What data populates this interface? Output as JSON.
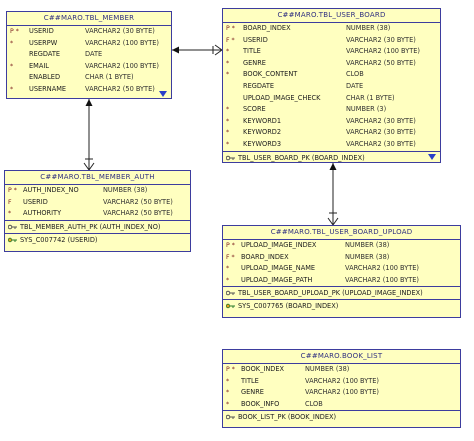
{
  "entities": {
    "member": {
      "title": "C##MARO.TBL_MEMBER",
      "columns": [
        {
          "flags": "P *",
          "name": "USERID",
          "type": "VARCHAR2 (30 BYTE)"
        },
        {
          "flags": "*",
          "name": "USERPW",
          "type": "VARCHAR2 (100 BYTE)"
        },
        {
          "flags": "",
          "name": "REGDATE",
          "type": "DATE"
        },
        {
          "flags": "*",
          "name": "EMAIL",
          "type": "VARCHAR2 (100 BYTE)"
        },
        {
          "flags": "",
          "name": "ENABLED",
          "type": "CHAR (1 BYTE)"
        },
        {
          "flags": "*",
          "name": "USERNAME",
          "type": "VARCHAR2 (50 BYTE)"
        }
      ]
    },
    "board": {
      "title": "C##MARO.TBL_USER_BOARD",
      "columns": [
        {
          "flags": "P *",
          "name": "BOARD_INDEX",
          "type": "NUMBER (38)"
        },
        {
          "flags": "F *",
          "name": "USERID",
          "type": "VARCHAR2 (30 BYTE)"
        },
        {
          "flags": "*",
          "name": "TITLE",
          "type": "VARCHAR2 (100 BYTE)"
        },
        {
          "flags": "*",
          "name": "GENRE",
          "type": "VARCHAR2 (50 BYTE)"
        },
        {
          "flags": "*",
          "name": "BOOK_CONTENT",
          "type": "CLOB"
        },
        {
          "flags": "",
          "name": "REGDATE",
          "type": "DATE"
        },
        {
          "flags": "",
          "name": "UPLOAD_IMAGE_CHECK",
          "type": "CHAR (1 BYTE)"
        },
        {
          "flags": "*",
          "name": "SCORE",
          "type": "NUMBER (3)"
        },
        {
          "flags": "*",
          "name": "KEYWORD1",
          "type": "VARCHAR2 (30 BYTE)"
        },
        {
          "flags": "*",
          "name": "KEYWORD2",
          "type": "VARCHAR2 (30 BYTE)"
        },
        {
          "flags": "*",
          "name": "KEYWORD3",
          "type": "VARCHAR2 (30 BYTE)"
        }
      ],
      "pk": "TBL_USER_BOARD_PK (BOARD_INDEX)"
    },
    "auth": {
      "title": "C##MARO.TBL_MEMBER_AUTH",
      "columns": [
        {
          "flags": "P *",
          "name": "AUTH_INDEX_NO",
          "type": "NUMBER (38)"
        },
        {
          "flags": "F",
          "name": "USERID",
          "type": "VARCHAR2 (50 BYTE)"
        },
        {
          "flags": "*",
          "name": "AUTHORITY",
          "type": "VARCHAR2 (50 BYTE)"
        }
      ],
      "pk": "TBL_MEMBER_AUTH_PK (AUTH_INDEX_NO)",
      "fk": "SYS_C007742 (USERID)"
    },
    "upload": {
      "title": "C##MARO.TBL_USER_BOARD_UPLOAD",
      "columns": [
        {
          "flags": "P *",
          "name": "UPLOAD_IMAGE_INDEX",
          "type": "NUMBER (38)"
        },
        {
          "flags": "F *",
          "name": "BOARD_INDEX",
          "type": "NUMBER (38)"
        },
        {
          "flags": "*",
          "name": "UPLOAD_IMAGE_NAME",
          "type": "VARCHAR2 (100 BYTE)"
        },
        {
          "flags": "*",
          "name": "UPLOAD_IMAGE_PATH",
          "type": "VARCHAR2 (100 BYTE)"
        }
      ],
      "pk": "TBL_USER_BOARD_UPLOAD_PK (UPLOAD_IMAGE_INDEX)",
      "fk": "SYS_C007765 (BOARD_INDEX)"
    },
    "book": {
      "title": "C##MARO.BOOK_LIST",
      "columns": [
        {
          "flags": "P *",
          "name": "BOOK_INDEX",
          "type": "NUMBER (38)"
        },
        {
          "flags": "*",
          "name": "TITLE",
          "type": "VARCHAR2 (100 BYTE)"
        },
        {
          "flags": "*",
          "name": "GENRE",
          "type": "VARCHAR2 (100 BYTE)"
        },
        {
          "flags": "*",
          "name": "BOOK_INFO",
          "type": "CLOB"
        }
      ],
      "pk": "BOOK_LIST_PK (BOOK_INDEX)"
    }
  },
  "colors": {
    "fill": "#ffffc0",
    "border": "#3d3d9e",
    "connector": "#222222",
    "arrow": "#2a3fc8"
  }
}
